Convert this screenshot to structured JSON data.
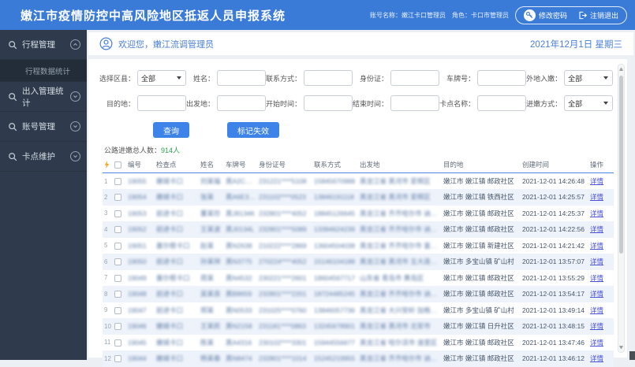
{
  "header": {
    "title": "嫩江市疫情防控中高风险地区抵返人员申报系统",
    "account": "账号名称：嫩江卡口管理员",
    "role": "角色：卡口市管理员",
    "change_password": "修改密码",
    "logout": "注销退出"
  },
  "sidebar": {
    "items": [
      {
        "label": "行程管理"
      },
      {
        "label": "出入管理统计"
      },
      {
        "label": "账号管理"
      },
      {
        "label": "卡点维护"
      }
    ],
    "submenu": {
      "label": "行程数据统计"
    }
  },
  "welcome": {
    "greeting": "欢迎您，嫩江流调管理员",
    "date": "2021年12月1日 星期三"
  },
  "filters": {
    "fields": [
      {
        "label": "选择区县：",
        "value": "全部"
      },
      {
        "label": "姓名：",
        "value": ""
      },
      {
        "label": "联系方式：",
        "value": ""
      },
      {
        "label": "身份证：",
        "value": ""
      },
      {
        "label": "车牌号：",
        "value": ""
      },
      {
        "label": "外地入嫩：",
        "value": "全部"
      },
      {
        "label": "目的地：",
        "value": ""
      },
      {
        "label": "出发地：",
        "value": ""
      },
      {
        "label": "开始时间：",
        "value": ""
      },
      {
        "label": "结束时间：",
        "value": ""
      },
      {
        "label": "卡点名称：",
        "value": ""
      },
      {
        "label": "进嫩方式：",
        "value": "全部"
      }
    ]
  },
  "actions": {
    "query": "查询",
    "mark_invalid": "标记失效"
  },
  "stats": {
    "label": "公路进嫩总人数：",
    "value": "914人"
  },
  "table": {
    "headers": [
      "编号",
      "检查点",
      "姓名",
      "车牌号",
      "身份证号",
      "联系方式",
      "出发地",
      "目的地",
      "创建时间",
      "操作"
    ],
    "action_label": "详情",
    "rows": [
      {
        "seq": "1",
        "id": "19055",
        "checkpoint": "嫩城卡口",
        "name": "刘某福",
        "plate": "黑A2C5J8",
        "idcard": "231221****5108",
        "phone": "15845670988",
        "origin": "黑龙江省 黑河市 爱辉区",
        "destination": "嫩江市 嫩江镇 邮政社区",
        "created": "2021-12-01 14:26:48"
      },
      {
        "seq": "2",
        "id": "19054",
        "checkpoint": "嫩城卡口",
        "name": "张某",
        "plate": "黑A6E303",
        "idcard": "231102****0523",
        "phone": "13846191118",
        "origin": "黑龙江省 黑河市 爱辉区",
        "destination": "嫩江市 嫩江镇 铁西社区",
        "created": "2021-12-01 14:25:57"
      },
      {
        "seq": "3",
        "id": "19053",
        "checkpoint": "前进卡口",
        "name": "董某珍",
        "plate": "黑J8134K",
        "idcard": "232801****4052",
        "phone": "18845126645",
        "origin": "黑龙江省 齐齐哈尔市 讷河市",
        "destination": "嫩江市 嫩江镇 邮政社区",
        "created": "2021-12-01 14:25:37"
      },
      {
        "seq": "4",
        "id": "19052",
        "checkpoint": "前进卡口",
        "name": "王某波",
        "plate": "黑J0134L",
        "idcard": "232801****5089",
        "phone": "13394624239",
        "origin": "黑龙江省 齐齐哈尔市 讷河市",
        "destination": "嫩江市 嫩江镇 邮政社区",
        "created": "2021-12-01 14:22:56"
      },
      {
        "seq": "5",
        "id": "19051",
        "checkpoint": "墨尔根卡口",
        "name": "赵某",
        "plate": "黑N2638",
        "idcard": "210222****2869",
        "phone": "13604504038",
        "origin": "黑龙江省 齐齐哈尔市 富裕县",
        "destination": "嫩江市 嫩江镇 新建社区",
        "created": "2021-12-01 14:21:42"
      },
      {
        "seq": "6",
        "id": "19050",
        "checkpoint": "前进卡口",
        "name": "孙某祥",
        "plate": "黑N3775",
        "idcard": "270224****4052",
        "phone": "15146104188",
        "origin": "黑龙江省 黑河市 五大连池市",
        "destination": "嫩江市 多宝山镇 矿山村",
        "created": "2021-12-01 13:57:07"
      },
      {
        "seq": "7",
        "id": "19049",
        "checkpoint": "墨尔根卡口",
        "name": "周某",
        "plate": "黑N4532",
        "idcard": "230221****2601",
        "phone": "18604567717",
        "origin": "山东省 青岛市 黄岛区",
        "destination": "嫩江市 嫩江镇 邮政社区",
        "created": "2021-12-01 13:55:29"
      },
      {
        "seq": "8",
        "id": "19048",
        "checkpoint": "前进卡口",
        "name": "吴某良",
        "plate": "黑B8659",
        "idcard": "232801****2201",
        "phone": "18724485245",
        "origin": "黑龙江省 齐齐哈尔市 讷河市",
        "destination": "嫩江市 嫩江镇 邮政社区",
        "created": "2021-12-01 13:54:17"
      },
      {
        "seq": "9",
        "id": "19047",
        "checkpoint": "前进卡口",
        "name": "郑某",
        "plate": "黑N0533",
        "idcard": "231025****0760",
        "phone": "13846057736",
        "origin": "黑龙江省 大兴安岭 加格达奇区",
        "destination": "嫩江市 多宝山镇 矿山村",
        "created": "2021-12-01 13:49:14"
      },
      {
        "seq": "10",
        "id": "19046",
        "checkpoint": "嫩城卡口",
        "name": "王某民",
        "plate": "黑N2158",
        "idcard": "231181****0863",
        "phone": "13245678901",
        "origin": "黑龙江省 黑河市 北安市",
        "destination": "嫩江市 嫩江镇 日升社区",
        "created": "2021-12-01 13:48:15"
      },
      {
        "seq": "11",
        "id": "19045",
        "checkpoint": "嫩城卡口",
        "name": "陈某",
        "plate": "黑A4316",
        "idcard": "230102****3301",
        "phone": "15944556677",
        "origin": "黑龙江省 哈尔滨市 道里区",
        "destination": "嫩江市 嫩江镇 邮政社区",
        "created": "2021-12-01 13:47:46"
      },
      {
        "seq": "12",
        "id": "19044",
        "checkpoint": "嫩城卡口",
        "name": "杨某春",
        "plate": "黑N8474",
        "idcard": "232801****1014",
        "phone": "15245219955",
        "origin": "黑龙江省 齐齐哈尔市 讷河市",
        "destination": "嫩江市 嫩江镇 邮政社区",
        "created": "2021-12-01 13:46:12"
      }
    ]
  }
}
